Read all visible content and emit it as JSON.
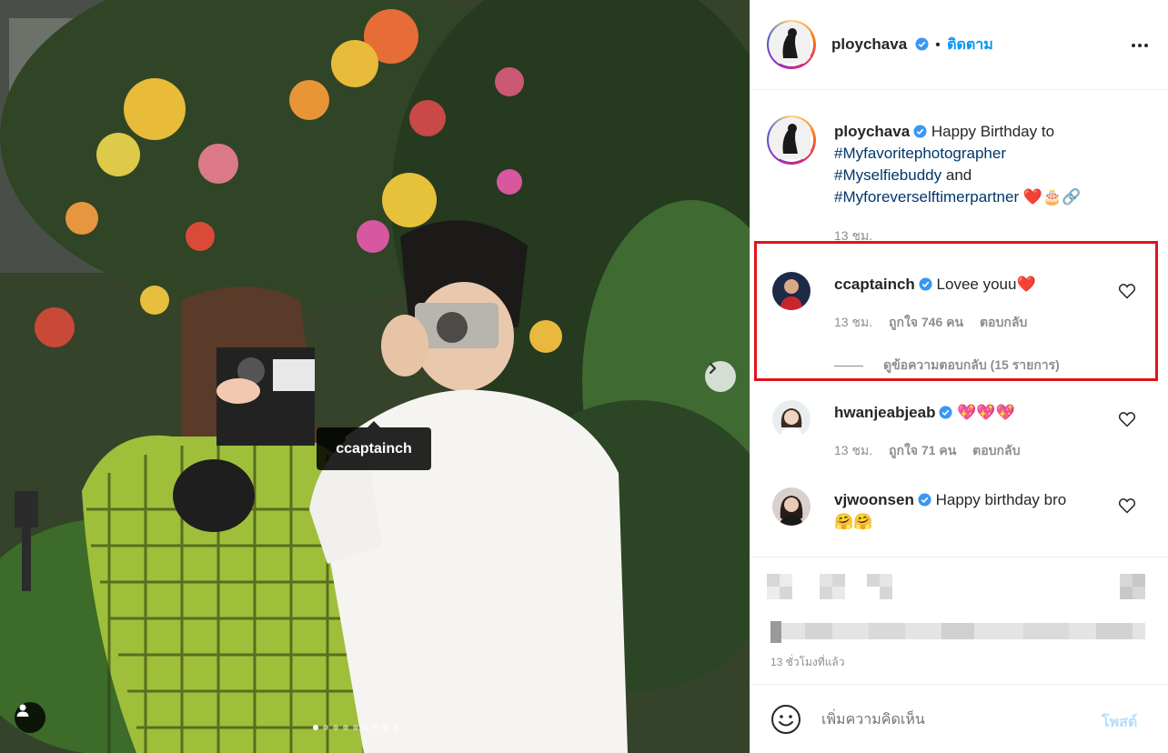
{
  "post": {
    "author": "ploychava",
    "follow_label": "ติดตาม",
    "separator": "•",
    "photo_tag": "ccaptainch",
    "carousel_count": 9,
    "carousel_active": 1
  },
  "caption": {
    "username": "ploychava",
    "line1": "Happy Birthday to",
    "tag1": "#Myfavoritephotographer",
    "tag2": "#Myselfiebuddy",
    "and_word": "and",
    "tag3": "#Myforeverselftimerpartner",
    "emoji": "❤️🎂🔗",
    "time": "13 ชม."
  },
  "comments": [
    {
      "username": "ccaptainch",
      "text": "Lovee youu❤️",
      "time": "13 ชม.",
      "likes": "ถูกใจ 746 คน",
      "reply": "ตอบกลับ",
      "view_replies": "ดูข้อความตอบกลับ (15 รายการ)"
    },
    {
      "username": "hwanjeabjeab",
      "text": "💖💖💖",
      "time": "13 ชม.",
      "likes": "ถูกใจ 71 คน",
      "reply": "ตอบกลับ"
    },
    {
      "username": "vjwoonsen",
      "text": "Happy birthday bro",
      "emoji": "🤗🤗"
    }
  ],
  "footer": {
    "posted_ago": "13 ชั่วโมงที่แล้ว",
    "add_comment_placeholder": "เพิ่มความคิดเห็น",
    "post_button": "โพสต์"
  },
  "colors": {
    "accent": "#0095f6",
    "highlight_box": "#e0131a",
    "heart": "#ed4956"
  }
}
